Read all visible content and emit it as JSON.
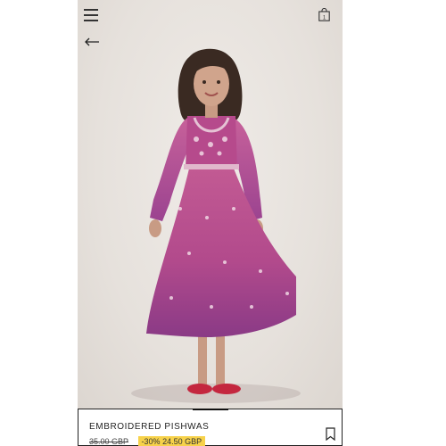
{
  "header": {
    "menu_icon": "hamburger-menu-icon",
    "bag_icon": "shopping-bag-icon",
    "back_icon": "back-arrow-icon",
    "bag_count": "1"
  },
  "product": {
    "name": "EMBROIDERED PISHWAS",
    "original_price": "35.00 GBP",
    "discount_label": "-30%",
    "sale_price": "24.50 GBP",
    "bookmark_icon": "bookmark-icon"
  },
  "colors": {
    "dress": "#b4508c",
    "dress_hem": "#8a3a86",
    "background": "#e9e5e1",
    "discount_badge": "#f7d24a",
    "shoes": "#c4273f"
  }
}
